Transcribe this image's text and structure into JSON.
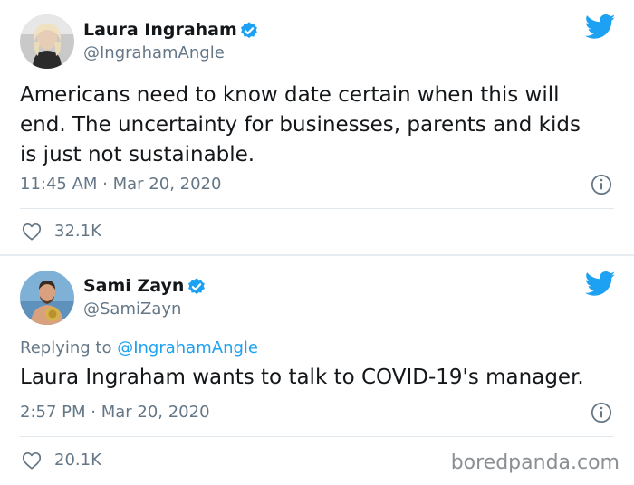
{
  "tweets": [
    {
      "display_name": "Laura Ingraham",
      "handle": "@IngrahamAngle",
      "verified": true,
      "body": "Americans need to know date certain when this will end.  The uncertainty for businesses, parents and kids is just not sustainable.",
      "timestamp": "11:45 AM · Mar 20, 2020",
      "likes": "32.1K"
    },
    {
      "display_name": "Sami Zayn",
      "handle": "@SamiZayn",
      "verified": true,
      "replying_prefix": "Replying to ",
      "replying_to": "@IngrahamAngle",
      "body": "Laura Ingraham wants to talk to COVID-19's manager.",
      "timestamp": "2:57 PM · Mar 20, 2020",
      "likes": "20.1K"
    }
  ],
  "watermark": "boredpanda.com",
  "colors": {
    "twitter_blue": "#1da1f2",
    "text": "#14171a",
    "muted": "#657786",
    "divider": "#e1e8ed"
  },
  "icons": [
    "twitter-bird-icon",
    "verified-badge-icon",
    "info-icon",
    "heart-icon"
  ]
}
